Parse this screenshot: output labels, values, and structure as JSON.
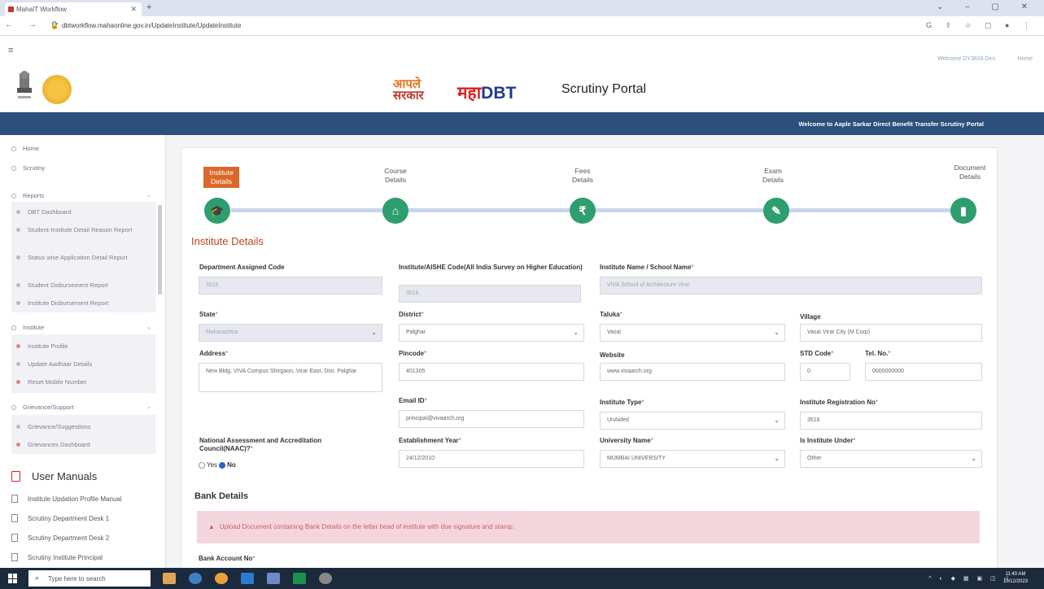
{
  "browser": {
    "tab_title": "MahaIT Workflow",
    "url": "dbtworkflow.mahaonline.gov.in/UpdateInstitute/UpdateInstitute"
  },
  "header": {
    "welcome_user": "Welcome DY3816 Dirs",
    "home_link": "Home",
    "aaple_top": "आपले",
    "aaple_bottom": "सरकार",
    "maha": "महा",
    "dbt": "DBT",
    "portal_title": "Scrutiny Portal",
    "banner_text": "Welcome to Aaple Sarkar Direct Benefit Transfer Scrutiny Portal"
  },
  "sidebar": {
    "home": "Home",
    "scrutiny": "Scrutiny",
    "reports": "Reports",
    "reports_items": [
      "DBT Dashboard",
      "Student-Institute Detail Reason Report",
      "Status wise Application Detail Report",
      "Student Disbursement Report",
      "Institute Disbursement Report"
    ],
    "institute": "Institute",
    "institute_items": [
      "Institute Profile",
      "Update Aadhaar Details",
      "Reset Mobile Number"
    ],
    "grievance": "Grievance/Support",
    "grievance_items": [
      "Grievance/Suggestions",
      "Grievances Dashboard"
    ],
    "user_manuals": "User Manuals",
    "manuals": [
      "Institute Updation Profile Manual",
      "Scrutiny Department Desk 1",
      "Scrutiny Department Desk 2",
      "Scrutiny Institute Principal"
    ]
  },
  "steps": [
    "Institute Details",
    "Course Details",
    "Fees Details",
    "Exam Details",
    "Document Details"
  ],
  "section_title": "Institute Details",
  "fields": {
    "dept_code_label": "Department Assigned Code",
    "dept_code_value": "3516",
    "aishe_label": "Institute/AISHE Code(All India Survey on Higher Education)",
    "aishe_value": "3516",
    "inst_name_label": "Institute Name / School Name",
    "inst_name_value": "VIVA School of Architecture Virar",
    "state_label": "State",
    "state_value": "Maharashtra",
    "district_label": "District",
    "district_value": "Palghar",
    "taluka_label": "Taluka",
    "taluka_value": "Vasai",
    "village_label": "Village",
    "village_value": "Vasai Virar City (M Corp)",
    "address_label": "Address",
    "address_value": "New Bldg, VIVA Compus Shirgaon, Virar East, Dist. Palghar",
    "pincode_label": "Pincode",
    "pincode_value": "401305",
    "website_label": "Website",
    "website_value": "www.vivaarch.org",
    "std_label": "STD Code",
    "std_value": "0",
    "tel_label": "Tel. No.",
    "tel_value": "0000000000",
    "email_label": "Email ID",
    "email_value": "principal@vivaarch.org",
    "inst_type_label": "Institute Type",
    "inst_type_value": "UnAided",
    "reg_no_label": "Institute Registration No",
    "reg_no_value": "3516",
    "naac_label": "National Assessment and Accreditation Council(NAAC)?",
    "naac_yes": "Yes",
    "naac_no": "No",
    "est_year_label": "Establishment Year",
    "est_year_value": "24/12/2010",
    "university_label": "University Name",
    "university_value": "MUMBAI UNIVERSITY",
    "under_label": "Is Institute Under",
    "under_value": "Other",
    "required_mark": "*"
  },
  "bank": {
    "title": "Bank Details",
    "alert": "Upload Document containing Bank Details on the letter head of institute with due signature and stamp.",
    "account_label": "Bank Account No"
  },
  "taskbar": {
    "search_placeholder": "Type here to search",
    "time": "11:40 AM",
    "date": "10/12/2023"
  }
}
